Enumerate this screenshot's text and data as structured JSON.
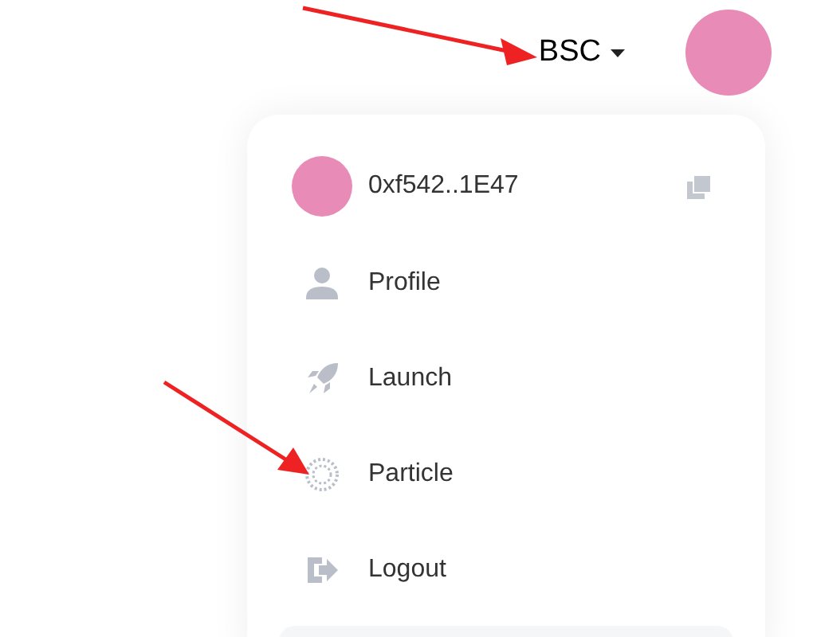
{
  "header": {
    "network": "BSC"
  },
  "account": {
    "address": "0xf542..1E47"
  },
  "menu": [
    {
      "kind": "profile",
      "label": "Profile"
    },
    {
      "kind": "launch",
      "label": "Launch"
    },
    {
      "kind": "particle",
      "label": "Particle"
    },
    {
      "kind": "logout",
      "label": "Logout"
    }
  ]
}
